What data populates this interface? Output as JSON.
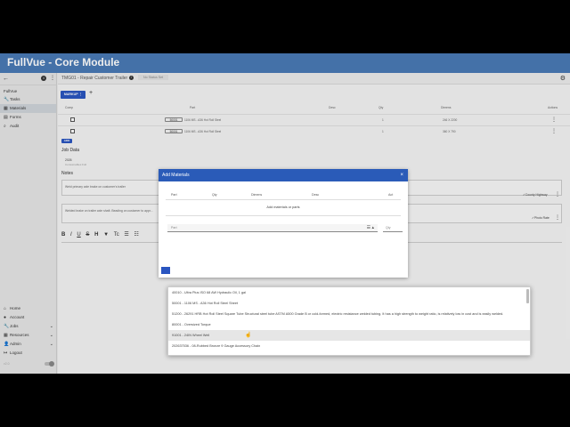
{
  "app": {
    "title": "FullVue - Core Module"
  },
  "sidebar": {
    "company": "FullVue",
    "items": [
      {
        "label": "Tasks",
        "icon": "wrench-icon"
      },
      {
        "label": "Materials",
        "icon": "box-icon",
        "active": true
      },
      {
        "label": "Forms",
        "icon": "form-icon"
      },
      {
        "label": "Audit",
        "icon": "search-icon"
      }
    ],
    "bottom_items": [
      {
        "label": "Home",
        "icon": "home-icon"
      },
      {
        "label": "Account",
        "icon": "account-icon"
      },
      {
        "label": "Jobs",
        "icon": "wrench-icon",
        "expand": true
      },
      {
        "label": "Resources",
        "icon": "grid-icon",
        "expand": true
      },
      {
        "label": "Admin",
        "icon": "person-icon",
        "expand": true
      },
      {
        "label": "Logout",
        "icon": "logout-icon"
      }
    ],
    "version": "v2.0"
  },
  "tabs": {
    "active": "TMG01 - Repair Customer Trailer",
    "second": "No Status Set"
  },
  "materials": {
    "markup_label": "MARKUP",
    "add_label": "+",
    "columns": [
      "Comp",
      "Part",
      "Desc",
      "Qty",
      "Dimens",
      "Actions"
    ],
    "rows": [
      {
        "part": "50001",
        "desc": "1106 MS - A36 Hot Roll Steel",
        "qty": "1",
        "dim": "246 X 2200"
      },
      {
        "part": "50001",
        "desc": "1106 MS - A36 Hot Roll Steel",
        "qty": "1",
        "dim": "360 X 790"
      }
    ],
    "add_button_label": "ADD"
  },
  "job_data": {
    "title": "Job Data",
    "field_value": "2026",
    "field_label": "Consumables Full"
  },
  "notes": {
    "title": "Notes",
    "note1": "Weld primary axle brake on customer's trailer",
    "note1_tag": "County Highway",
    "note2": "Welded brake on trailer axle shaft. Beading on customer to appr...",
    "note2_tag": "Photo Rate"
  },
  "dialog": {
    "title": "Add Materials",
    "close_icon": "×",
    "columns": [
      "Part",
      "Qty",
      "Dimens",
      "Desc",
      "Act"
    ],
    "empty_text": "Add materials or parts",
    "picker_placeholder": "Part",
    "qty_placeholder": "Qty"
  },
  "dropdown": {
    "options": [
      "40010 - Ultra Plus ISO 68 AW Hydraulic Oil, 1 gal",
      "50001 - 1106 MS - A36 Hot Roll Steel Sheet",
      "51200 - 26291 HRB Hot Roll Steel Square Tube Structural steel tube ASTM A500 Grade B or cold-formed, electric resistance welded tubing. It has a high strength to weight ratio, is relatively low in cost and is easily welded.",
      "80001 - Oversized Torque",
      "91001 - 24IN Wheel Well",
      "202637536 - 08-Rubbed Bronze 9 Gauge Accessory Chain"
    ],
    "hover_index": 4
  }
}
